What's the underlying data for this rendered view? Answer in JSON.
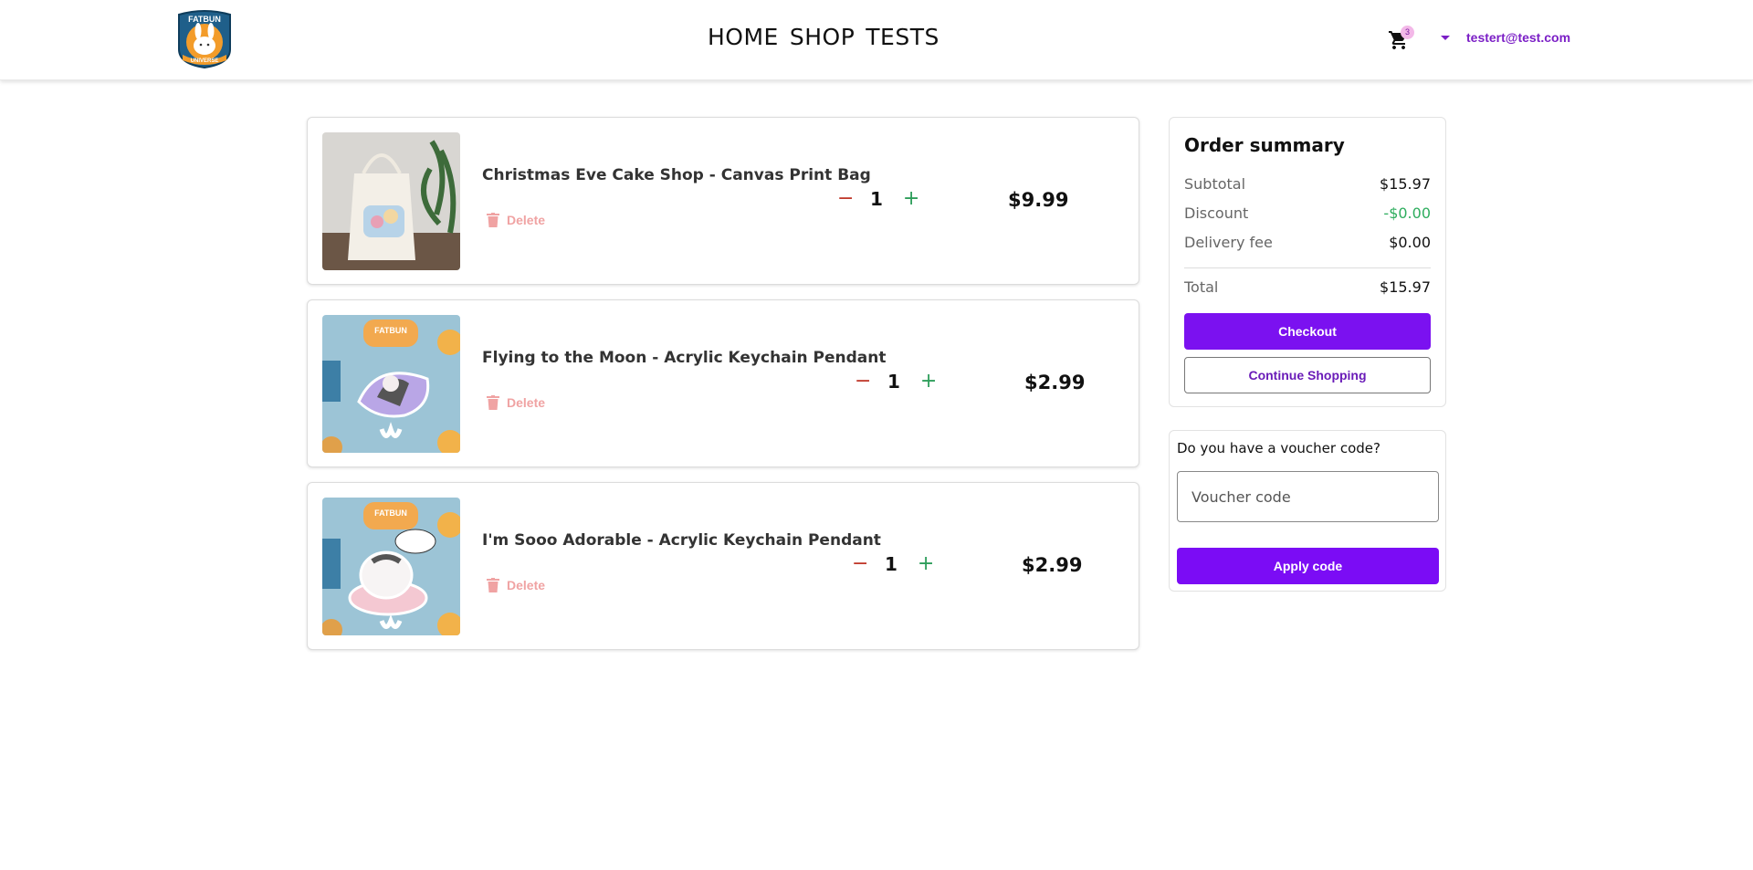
{
  "header": {
    "logo_text_top": "FATBUN",
    "logo_text_bottom": "UNIVERSE",
    "nav": [
      "HOME",
      "SHOP",
      "TESTS"
    ],
    "cart_count": "3",
    "account_email": "testert@test.com"
  },
  "cart": {
    "delete_label": "Delete",
    "items": [
      {
        "name": "Christmas Eve Cake Shop - Canvas Print Bag",
        "quantity": "1",
        "price": "$9.99",
        "image": "canvas-tote-bag"
      },
      {
        "name": "Flying to the Moon - Acrylic Keychain Pendant",
        "quantity": "1",
        "price": "$2.99",
        "image": "acrylic-keychain-moon"
      },
      {
        "name": "I'm Sooo Adorable - Acrylic Keychain Pendant",
        "quantity": "1",
        "price": "$2.99",
        "image": "acrylic-keychain-adorable"
      }
    ]
  },
  "summary": {
    "title": "Order summary",
    "subtotal_label": "Subtotal",
    "subtotal_value": "$15.97",
    "discount_label": "Discount",
    "discount_value": "-$0.00",
    "delivery_label": "Delivery fee",
    "delivery_value": "$0.00",
    "total_label": "Total",
    "total_value": "$15.97",
    "checkout_label": "Checkout",
    "continue_label": "Continue Shopping"
  },
  "voucher": {
    "question": "Do you have a voucher code?",
    "placeholder": "Voucher code",
    "apply_label": "Apply code"
  },
  "colors": {
    "accent": "#7b11f0",
    "link": "#7b1fc6",
    "discount_green": "#2ead5e",
    "delete_red": "#f0a3a3",
    "minus_red": "#c0392b",
    "plus_green": "#2e9e5b"
  }
}
